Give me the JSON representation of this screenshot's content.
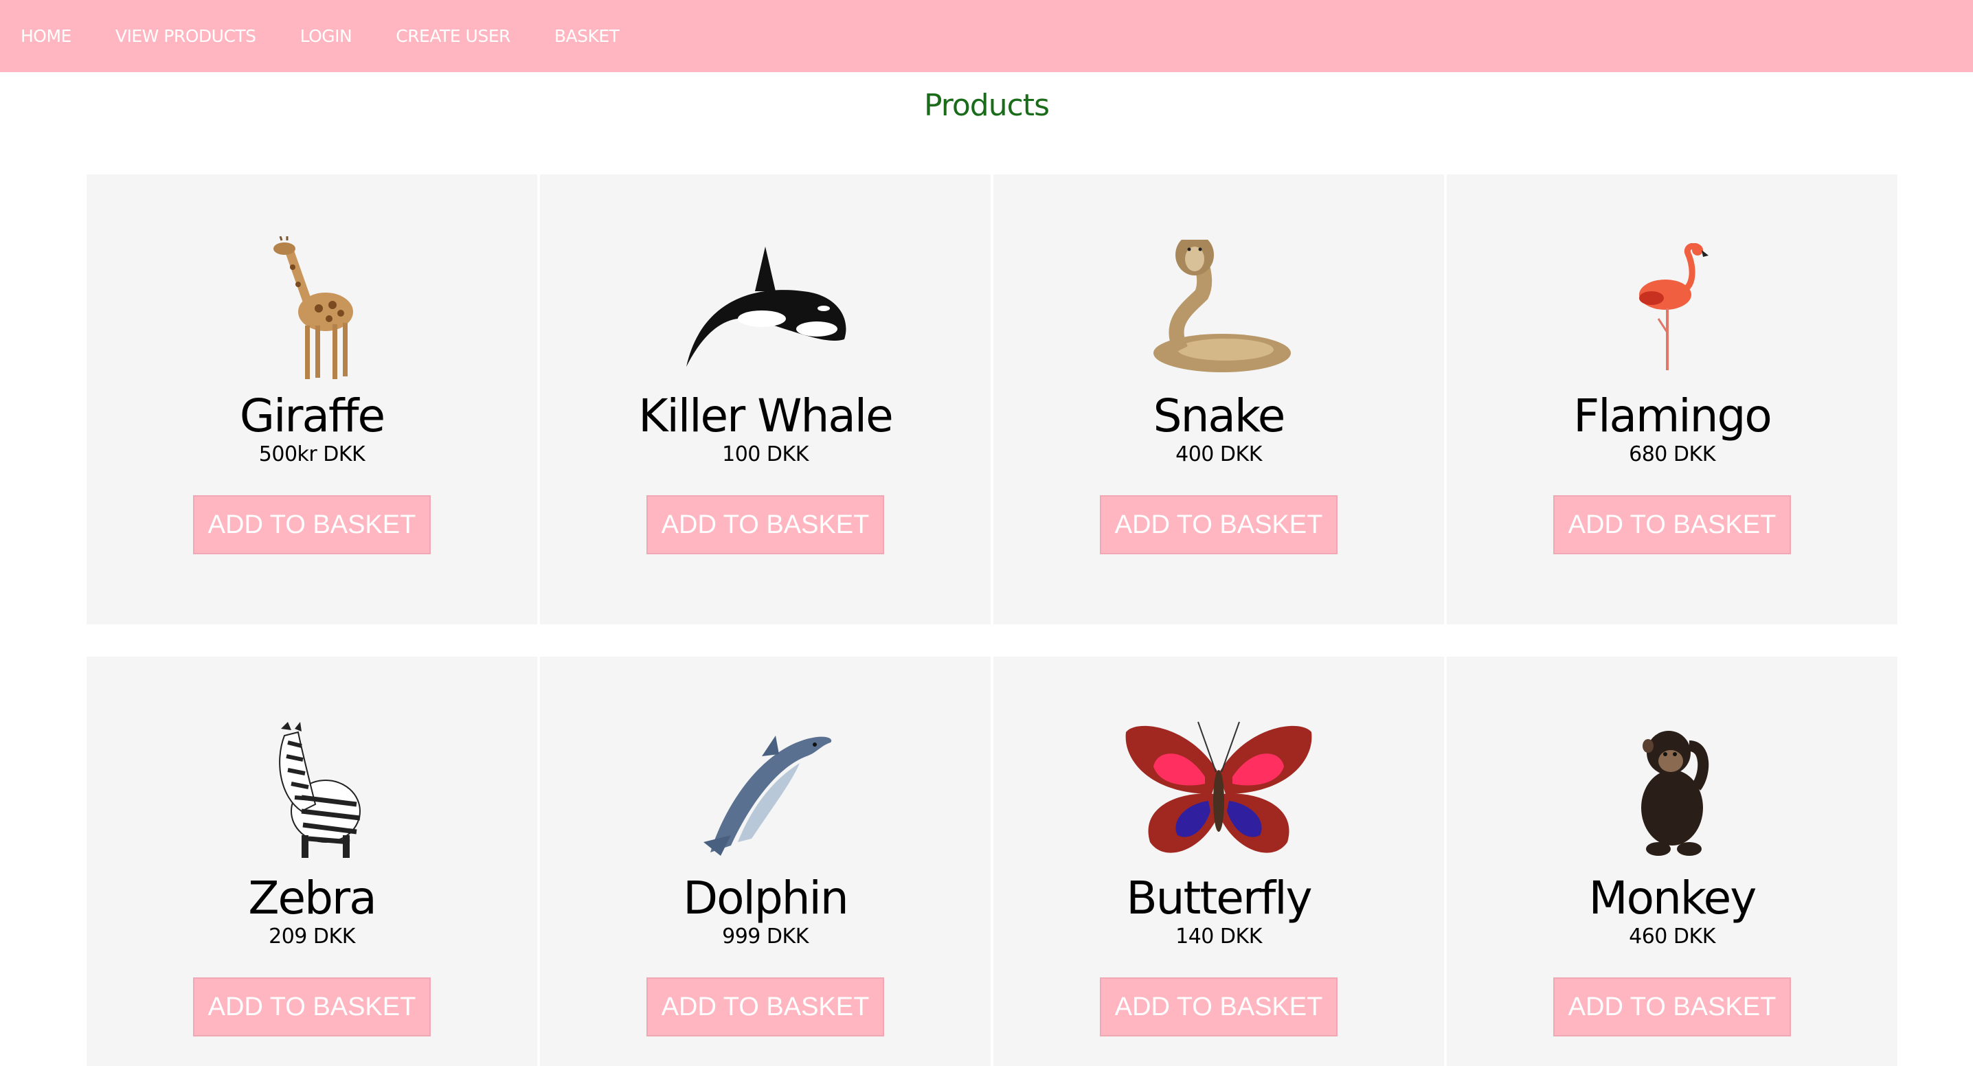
{
  "nav": {
    "items": [
      {
        "label": "HOME"
      },
      {
        "label": "VIEW PRODUCTS"
      },
      {
        "label": "LOGIN"
      },
      {
        "label": "CREATE USER"
      },
      {
        "label": "BASKET"
      }
    ]
  },
  "colors": {
    "brand_pink": "#ffb6c1",
    "title_green": "#1a6b1a",
    "card_bg": "#f5f5f5"
  },
  "page": {
    "title": "Products"
  },
  "products": [
    {
      "name": "Giraffe",
      "price": "500kr DKK",
      "button": "ADD TO BASKET",
      "icon": "giraffe-icon"
    },
    {
      "name": "Killer Whale",
      "price": "100 DKK",
      "button": "ADD TO BASKET",
      "icon": "killer-whale-icon"
    },
    {
      "name": "Snake",
      "price": "400 DKK",
      "button": "ADD TO BASKET",
      "icon": "snake-icon"
    },
    {
      "name": "Flamingo",
      "price": "680 DKK",
      "button": "ADD TO BASKET",
      "icon": "flamingo-icon"
    },
    {
      "name": "Zebra",
      "price": "209 DKK",
      "button": "ADD TO BASKET",
      "icon": "zebra-icon"
    },
    {
      "name": "Dolphin",
      "price": "999 DKK",
      "button": "ADD TO BASKET",
      "icon": "dolphin-icon"
    },
    {
      "name": "Butterfly",
      "price": "140 DKK",
      "button": "ADD TO BASKET",
      "icon": "butterfly-icon"
    },
    {
      "name": "Monkey",
      "price": "460 DKK",
      "button": "ADD TO BASKET",
      "icon": "monkey-icon"
    }
  ]
}
